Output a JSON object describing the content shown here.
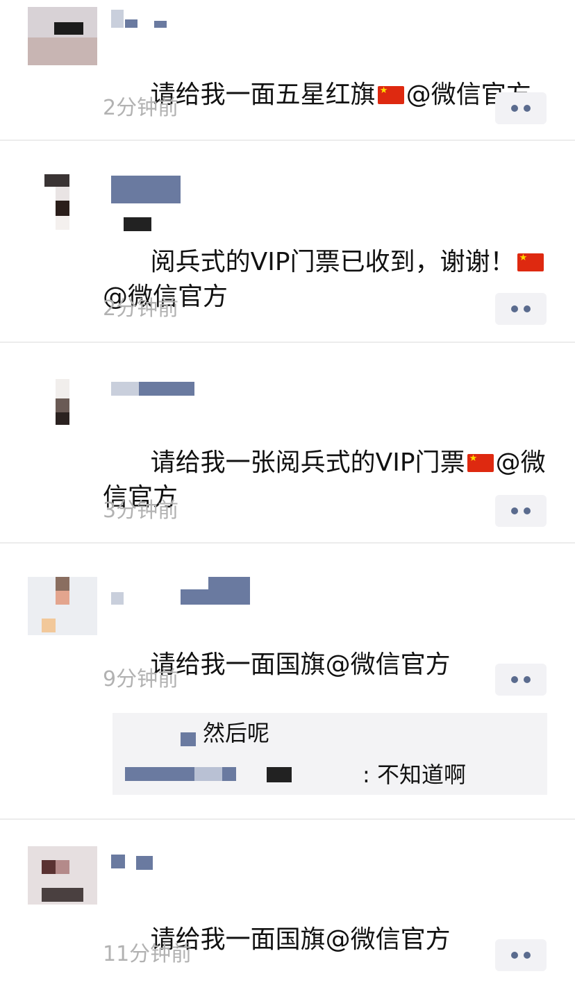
{
  "colors": {
    "background": "#ffffff",
    "text": "#111111",
    "timestamp": "#b2b2b2",
    "divider": "#ececec",
    "more_button_bg": "#f2f2f5",
    "more_dots": "#5a6b8e",
    "reply_bg": "#f3f3f5",
    "flag_red": "#de2910",
    "flag_star": "#ffde00"
  },
  "icons": {
    "flag": "china-flag-icon",
    "more": "more-options-icon"
  },
  "comments": [
    {
      "text_before_flag": "请给我一面五星红旗",
      "has_flag": true,
      "text_after_flag": "@微信官方",
      "time": "2分钟前"
    },
    {
      "text_before_flag": "阅兵式的VIP门票已收到，谢谢！",
      "has_flag": true,
      "text_after_flag": "@微信官方",
      "time": "2分钟前"
    },
    {
      "text_before_flag": "请给我一张阅兵式的VIP门票",
      "has_flag": true,
      "text_after_flag": "@微信官方",
      "time": "3分钟前"
    },
    {
      "text_before_flag": "请给我一面国旗@微信官方",
      "has_flag": false,
      "text_after_flag": "",
      "time": "9分钟前",
      "replies": [
        {
          "text": "然后呢"
        },
        {
          "text": ": 不知道啊"
        }
      ]
    },
    {
      "text_before_flag": "请给我一面国旗@微信官方",
      "has_flag": false,
      "text_after_flag": "",
      "time": "11分钟前"
    }
  ]
}
